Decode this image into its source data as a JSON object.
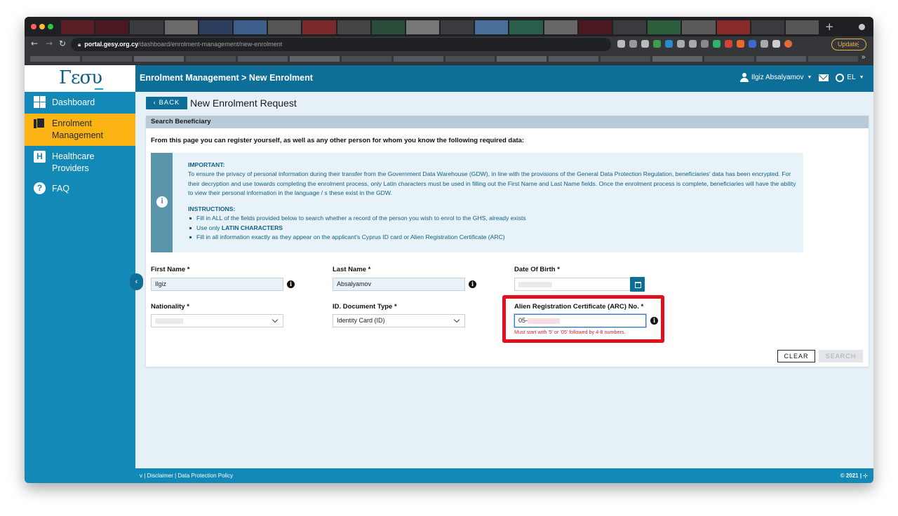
{
  "browser": {
    "url_host": "portal.gesy.org.cy",
    "url_path": "/dashboard/enrolment-management/new-enrolment",
    "new_tab": "+",
    "update_label": "Update",
    "more": "⋮",
    "bookmarks_more": "»"
  },
  "brand": {
    "logo_text": "Γεσυ"
  },
  "header": {
    "breadcrumb": "Enrolment Management > New Enrolment",
    "user_name": "Ilgiz Absalyamov",
    "lang": "EL"
  },
  "sidebar": {
    "items": [
      {
        "label": "Dashboard",
        "icon": "dashboard-icon"
      },
      {
        "label": "Enrolment\nManagement",
        "icon": "documents-icon"
      },
      {
        "label": "Healthcare\nProviders",
        "icon": "hospital-icon"
      },
      {
        "label": "FAQ",
        "icon": "question-icon"
      }
    ],
    "hospital_letter": "H",
    "faq_letter": "?"
  },
  "page": {
    "back_label": "BACK",
    "title": "New Enrolment Request"
  },
  "search_card": {
    "header": "Search Beneficiary",
    "intro": "From this page you can register yourself, as well as any other person for whom you know the following required data:",
    "info_letter": "i",
    "important_heading": "IMPORTANT:",
    "important_text": "To ensure the privacy of personal information during their transfer from the Government Data Warehouse (GDW), in line with the provisions of the General Data Protection Regulation, beneficiaries' data has been encrypted. For their decryption and use towards completing the enrolment process, only Latin characters must be used in filling out the First Name and Last Name fields. Once the enrolment process is complete, beneficiaries will have the ability to view their personal information in the language / s these exist in the GDW.",
    "instructions_heading": "INSTRUCTIONS:",
    "instructions": [
      {
        "pre": "Fill in ALL of the fields provided below to search whether a record of the person you wish to enrol to the GHS, already exists",
        "bold": ""
      },
      {
        "pre": "Use only ",
        "bold": "LATIN CHARACTERS"
      },
      {
        "pre": "Fill in all information exactly as they appear on the applicant's Cyprus ID card or Alien Registration Certificate (ARC)",
        "bold": ""
      }
    ],
    "fields": {
      "first_name_label": "First Name *",
      "first_name_value": "Ilgiz",
      "last_name_label": "Last Name *",
      "last_name_value": "Absalyamov",
      "dob_label": "Date Of Birth *",
      "nationality_label": "Nationality *",
      "doc_type_label": "ID. Document Type *",
      "doc_type_value": "Identity Card (ID)",
      "arc_label": "Alien Registration Certificate (ARC) No. *",
      "arc_value_prefix": "05-",
      "arc_error": "Must start with '5' or '05' followed by 4-8 numbers."
    },
    "info_letter_small": "i",
    "clear_label": "CLEAR",
    "search_label": "SEARCH"
  },
  "footer": {
    "links": "v  |  Disclaimer  |  Data Protection Policy",
    "copyright": "© 2021  |"
  },
  "colors": {
    "primary": "#1289b6",
    "primary_dark": "#0d6f98",
    "active_nav": "#fcb415",
    "error": "#e1101c"
  }
}
